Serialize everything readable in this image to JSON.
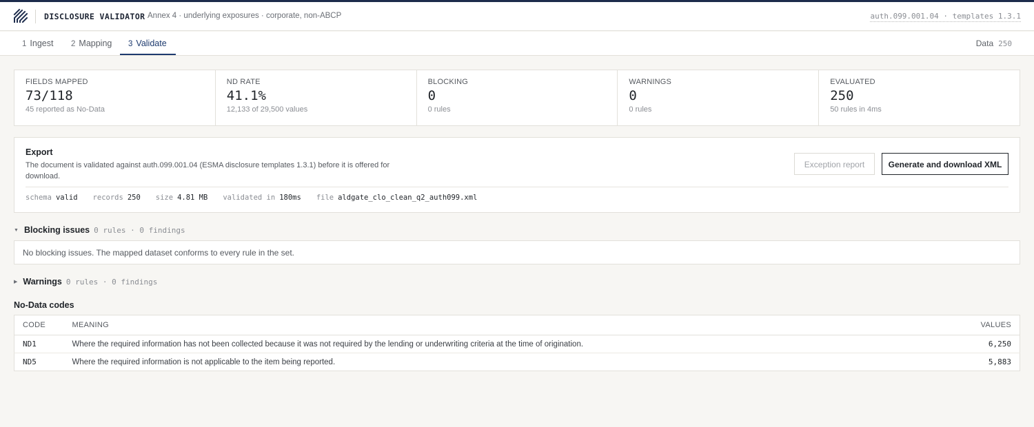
{
  "app": {
    "title": "DISCLOSURE VALIDATOR",
    "subtitle": "Annex 4 · underlying exposures · corporate, non-ABCP",
    "version": "auth.099.001.04 · templates 1.3.1",
    "brand_color": "#1d2c4c"
  },
  "tabs": [
    {
      "num": "1",
      "label": "Ingest"
    },
    {
      "num": "2",
      "label": "Mapping"
    },
    {
      "num": "3",
      "label": "Validate",
      "active": true
    }
  ],
  "data_count": {
    "label": "Data",
    "value": "250"
  },
  "stats": [
    {
      "label": "FIELDS MAPPED",
      "value": "73/118",
      "sub": "45 reported as No-Data"
    },
    {
      "label": "ND RATE",
      "value": "41.1%",
      "sub": "12,133 of 29,500 values"
    },
    {
      "label": "BLOCKING",
      "value": "0",
      "sub": "0 rules"
    },
    {
      "label": "WARNINGS",
      "value": "0",
      "sub": "0 rules"
    },
    {
      "label": "EVALUATED",
      "value": "250",
      "sub": "50 rules in 4ms"
    }
  ],
  "export": {
    "title": "Export",
    "description": "The document is validated against auth.099.001.04 (ESMA disclosure templates 1.3.1) before it is offered for download.",
    "exception_button": "Exception report",
    "generate_button": "Generate and download XML",
    "meta": {
      "schema_key": "schema",
      "schema_val": "valid",
      "records_key": "records",
      "records_val": "250",
      "size_key": "size",
      "size_val": "4.81 MB",
      "validated_key": "validated in",
      "validated_val": "180ms",
      "file_key": "file",
      "file_val": "aldgate_clo_clean_q2_auth099.xml"
    }
  },
  "blocking": {
    "title": "Blocking issues",
    "count": "0 rules · 0 findings",
    "message": "No blocking issues. The mapped dataset conforms to every rule in the set.",
    "arrow_icon": "chevron-down-icon"
  },
  "warnings": {
    "title": "Warnings",
    "count": "0 rules · 0 findings",
    "arrow_icon": "chevron-right-icon"
  },
  "nodata": {
    "title": "No-Data codes",
    "headers": {
      "code": "CODE",
      "meaning": "MEANING",
      "values": "VALUES"
    },
    "rows": [
      {
        "code": "ND1",
        "meaning": "Where the required information has not been collected because it was not required by the lending or underwriting criteria at the time of origination.",
        "values": "6,250"
      },
      {
        "code": "ND5",
        "meaning": "Where the required information is not applicable to the item being reported.",
        "values": "5,883"
      }
    ]
  }
}
